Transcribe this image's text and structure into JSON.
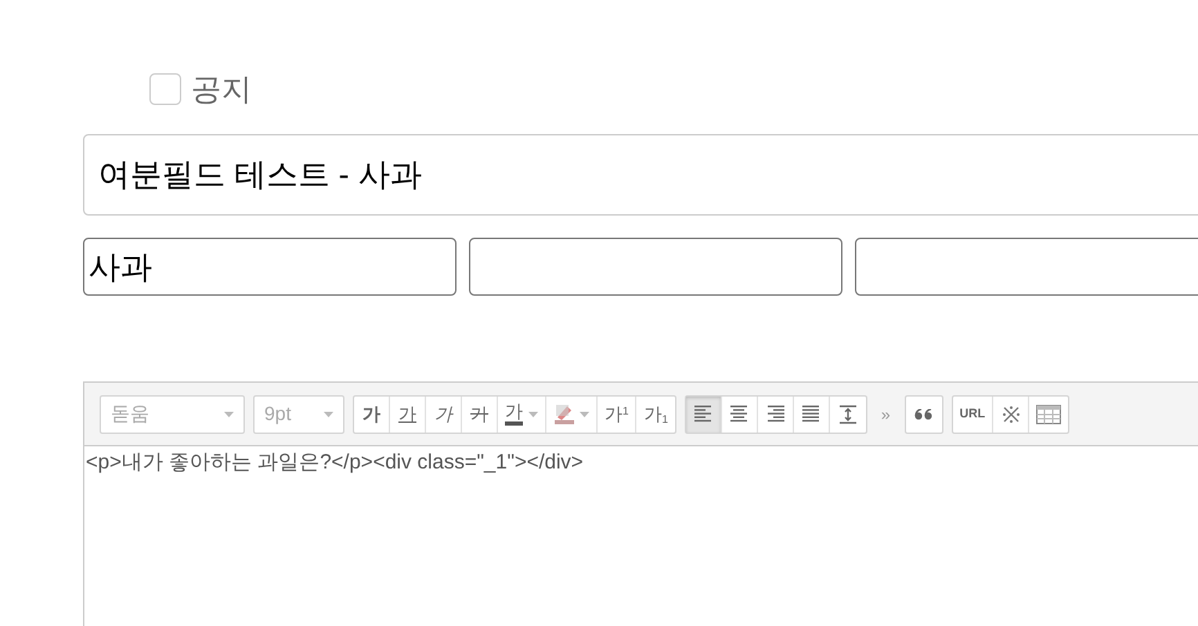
{
  "notice": {
    "label": "공지",
    "checked": false
  },
  "title_field": {
    "value": "여분필드 테스트 - 사과"
  },
  "extra_fields": [
    {
      "kind": "text",
      "value": "사과"
    },
    {
      "kind": "text"
    },
    {
      "kind": "text"
    }
  ],
  "editor": {
    "font_select": "돋움",
    "size_select": "9pt",
    "toolbar_groups": [
      {
        "buttons": [
          {
            "kind": "bold",
            "label": "가"
          },
          {
            "kind": "underline",
            "label": "가"
          },
          {
            "kind": "italic",
            "label": "가"
          },
          {
            "kind": "strike",
            "label": "가"
          },
          {
            "kind": "color",
            "label": "가"
          },
          {
            "kind": "highlight"
          },
          {
            "kind": "sup",
            "label": "가",
            "mark": "1"
          },
          {
            "kind": "sub",
            "label": "가",
            "mark": "1"
          }
        ]
      },
      {
        "buttons": [
          {
            "kind": "align-left",
            "selected": true
          },
          {
            "kind": "align-center",
            "selected": false
          },
          {
            "kind": "align-right",
            "selected": false
          },
          {
            "kind": "align-justify",
            "selected": false
          },
          {
            "kind": "line-height",
            "selected": false
          }
        ]
      },
      {
        "kind": "more",
        "label": "»"
      },
      {
        "buttons": [
          {
            "kind": "quote"
          }
        ]
      },
      {
        "buttons": [
          {
            "kind": "url",
            "label": "URL"
          },
          {
            "kind": "special"
          },
          {
            "kind": "table"
          }
        ]
      }
    ],
    "content": "<p>내가 좋아하는 과일은?</p><div class=\"_1\"></div>"
  }
}
